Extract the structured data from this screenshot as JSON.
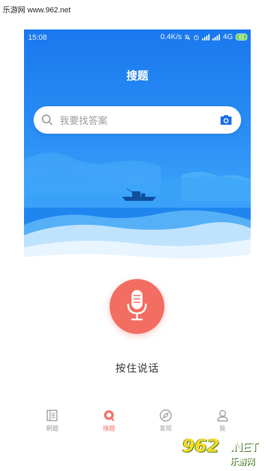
{
  "watermark": {
    "top_text": "乐游网 www.962.net",
    "logo_main": "962",
    "logo_net": ".NET",
    "logo_sub": "乐游网"
  },
  "status_bar": {
    "time": "15:08",
    "speed": "0.4K/s",
    "network": "4G",
    "battery": "65"
  },
  "header": {
    "title": "搜题"
  },
  "search": {
    "placeholder": "我要找答案",
    "icons": [
      "search-icon",
      "camera-icon"
    ]
  },
  "voice": {
    "label": "按住说话",
    "icon": "microphone-icon"
  },
  "tabbar": {
    "tabs": [
      {
        "label": "刷题",
        "icon": "list-icon",
        "active": false
      },
      {
        "label": "搜题",
        "icon": "search-tab-icon",
        "active": true
      },
      {
        "label": "发现",
        "icon": "compass-icon",
        "active": false
      },
      {
        "label": "我",
        "icon": "person-icon",
        "active": false
      }
    ]
  },
  "colors": {
    "hero_blue": "#1a78ee",
    "accent_red": "#f26e63",
    "tab_inactive": "#9a9a9a"
  }
}
